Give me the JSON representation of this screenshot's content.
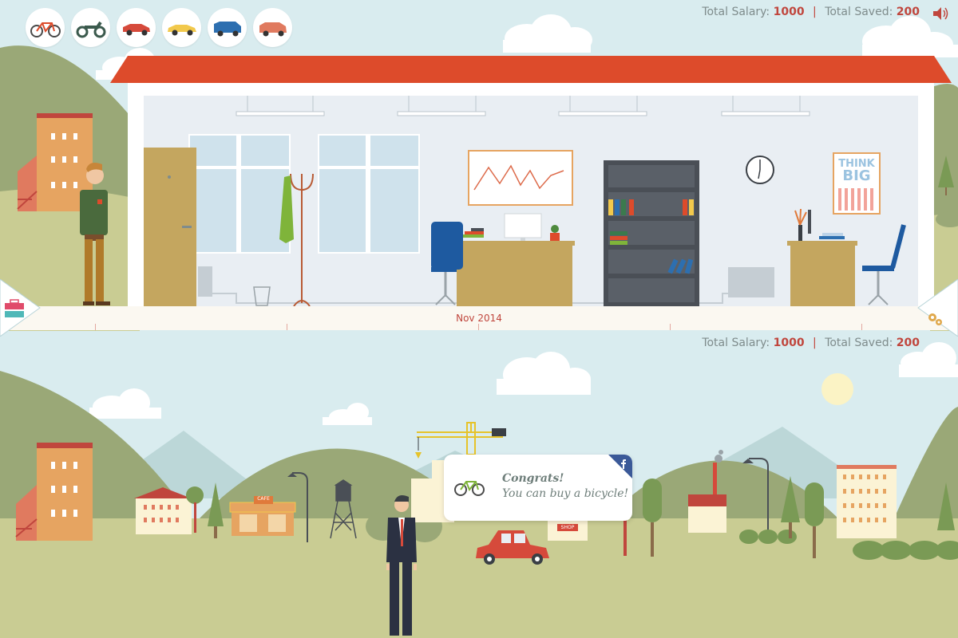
{
  "vehicles": [
    {
      "name": "bicycle",
      "color": "#4a4a4a"
    },
    {
      "name": "scooter",
      "color": "#3b5a4d"
    },
    {
      "name": "red-car",
      "color": "#d64a3b"
    },
    {
      "name": "yellow-car",
      "color": "#f2c94c"
    },
    {
      "name": "blue-suv",
      "color": "#2d6fb0"
    },
    {
      "name": "salmon-suv",
      "color": "#e07a5f"
    }
  ],
  "stats_top": {
    "salary_label": "Total Salary:",
    "salary_value": "1000",
    "saved_label": "Total Saved:",
    "saved_value": "200",
    "separator": "|"
  },
  "stats_bottom": {
    "salary_label": "Total Salary:",
    "salary_value": "1000",
    "saved_label": "Total Saved:",
    "saved_value": "200",
    "separator": "|"
  },
  "timeline": {
    "label": "Nov 2014"
  },
  "poster": {
    "line1": "THINK",
    "line2": "BIG"
  },
  "sign_cafe": "CAFE",
  "sign_shop": "SHOP",
  "popup": {
    "title": "Congrats!",
    "message": "You can buy a bicycle!",
    "icon": "bicycle-icon"
  },
  "colors": {
    "roof": "#dd4b2b",
    "accent": "#c0463d",
    "hill": "#9aa877",
    "grass": "#c9cc93",
    "sky": "#d9ecef",
    "building": "#e6a461"
  }
}
